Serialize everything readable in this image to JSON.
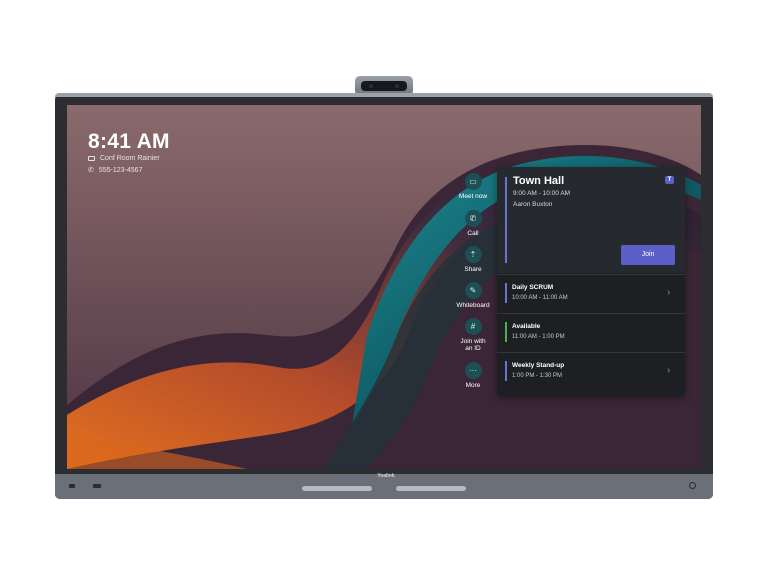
{
  "device": {
    "brand": "Yealink"
  },
  "home": {
    "clock": "8:41 AM",
    "room": "Conf Room Rainier",
    "phone": "555-123-4567"
  },
  "actions": [
    {
      "label": "Meet now",
      "icon": "video-camera-icon"
    },
    {
      "label": "Call",
      "icon": "phone-icon"
    },
    {
      "label": "Share",
      "icon": "share-screen-icon"
    },
    {
      "label": "Whiteboard",
      "icon": "whiteboard-icon"
    },
    {
      "label_line1": "Join with",
      "label_line2": "an ID",
      "icon": "hash-icon"
    },
    {
      "label": "More",
      "icon": "more-icon"
    }
  ],
  "calendar": {
    "current": {
      "title": "Town Hall",
      "time": "9:00 AM - 10:00 AM",
      "organizer": "Aaron Buxton",
      "join_label": "Join",
      "accent": "#6b72d6"
    },
    "items": [
      {
        "name": "Daily SCRUM",
        "time": "10:00 AM - 11:00 AM",
        "color": "#6b72d6",
        "has_chevron": true
      },
      {
        "name": "Available",
        "time": "11:00 AM - 1:00 PM",
        "color": "#4caf50",
        "has_chevron": false
      },
      {
        "name": "Weekly Stand-up",
        "time": "1:00 PM - 1:30 PM",
        "color": "#6b72d6",
        "has_chevron": true
      }
    ]
  },
  "colors": {
    "accent": "#5b5fc7",
    "action_circle": "#1d4f55"
  }
}
